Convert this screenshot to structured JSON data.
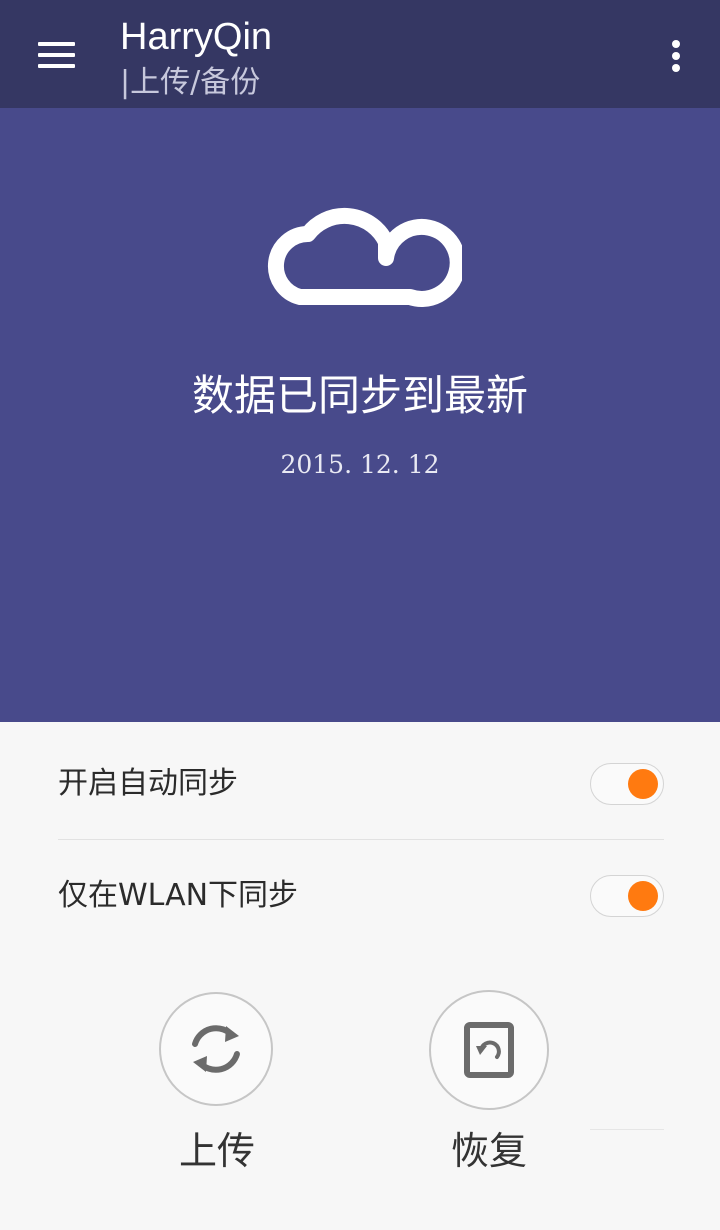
{
  "header": {
    "title": "HarryQin",
    "subtitle": "|上传/备份",
    "menu_icon": "hamburger-menu-icon",
    "overflow_icon": "more-vertical-icon"
  },
  "hero": {
    "icon": "mi-cloud-icon",
    "status": "数据已同步到最新",
    "date": "2015. 12. 12"
  },
  "settings": {
    "auto_sync": {
      "label": "开启自动同步",
      "enabled": true
    },
    "wlan_only": {
      "label": "仅在WLAN下同步",
      "enabled": true
    }
  },
  "actions": {
    "upload": {
      "label": "上传",
      "icon": "sync-icon"
    },
    "restore": {
      "label": "恢复",
      "icon": "restore-icon"
    }
  },
  "colors": {
    "appbar": "#353763",
    "hero": "#484a8b",
    "toggle_on": "#ff7a10",
    "background": "#f7f7f7"
  }
}
